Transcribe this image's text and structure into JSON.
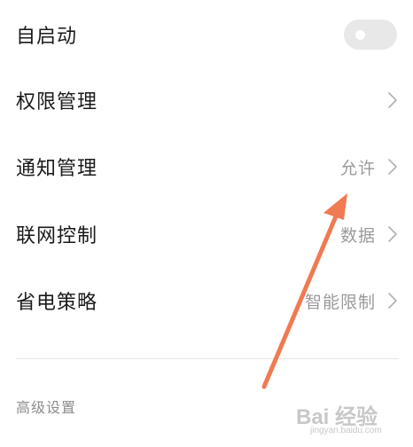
{
  "settings": {
    "rows": [
      {
        "label": "自启动",
        "value": "",
        "control": "toggle",
        "toggle_on": false
      },
      {
        "label": "权限管理",
        "value": "",
        "control": "chevron"
      },
      {
        "label": "通知管理",
        "value": "允许",
        "control": "chevron"
      },
      {
        "label": "联网控制",
        "value": "数据",
        "control": "chevron"
      },
      {
        "label": "省电策略",
        "value": "智能限制",
        "control": "chevron"
      }
    ],
    "section_header": "高级设置"
  },
  "annotation": {
    "arrow_color": "#f07a52"
  },
  "watermark": {
    "brand": "Bai 经验",
    "site": "jingyan.baidu.com"
  },
  "colors": {
    "label": "#1a1a1a",
    "value": "#9a9a9a",
    "toggle_off": "#e8e8e8",
    "divider": "#e5e5e5"
  }
}
